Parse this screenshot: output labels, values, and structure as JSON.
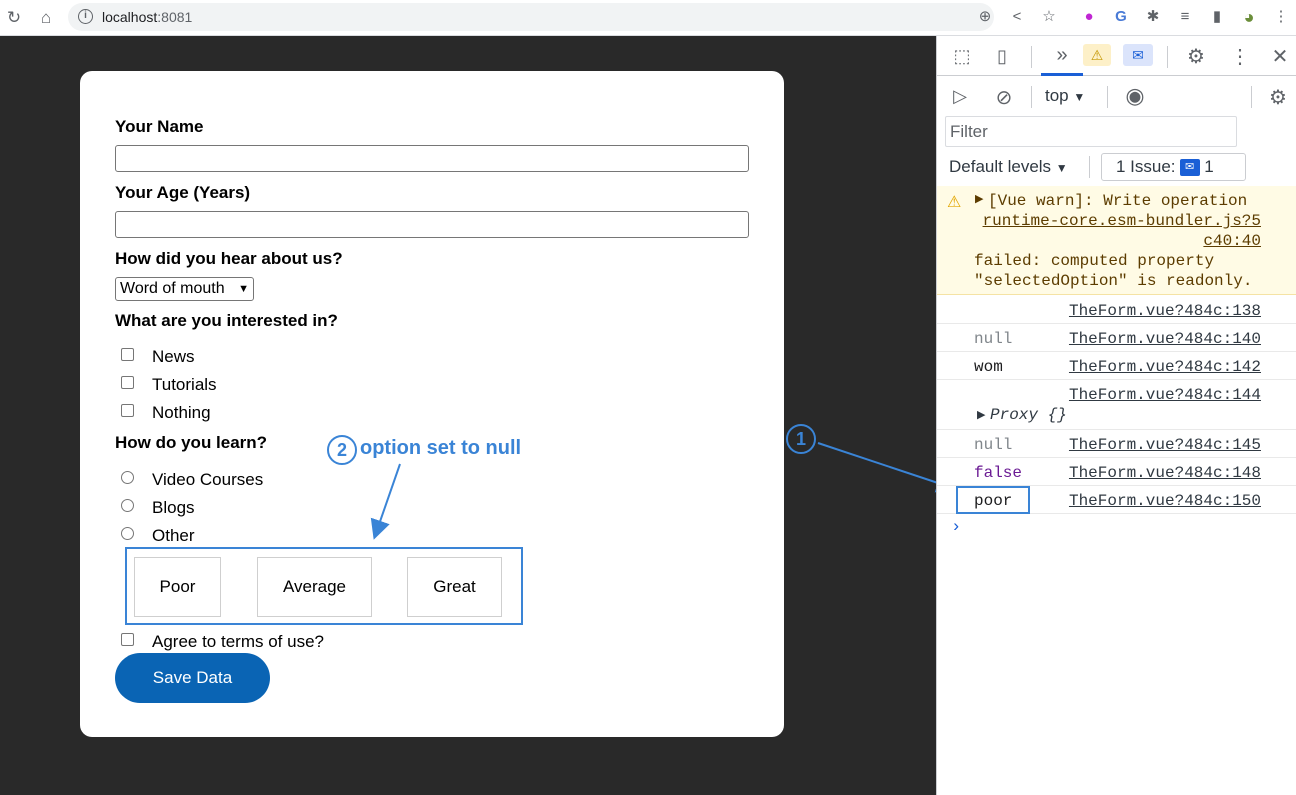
{
  "browser": {
    "url_host": "localhost",
    "url_port": ":8081",
    "back_glyph": "↻",
    "home_glyph": "⌂",
    "info_glyph": "i",
    "toolbar_icons": [
      {
        "name": "zoom-icon",
        "glyph": "⊕"
      },
      {
        "name": "share-icon",
        "glyph": "<"
      },
      {
        "name": "star-icon",
        "glyph": "☆"
      },
      {
        "name": "extension-a-icon",
        "glyph": "●"
      },
      {
        "name": "translate-icon",
        "glyph": "G"
      },
      {
        "name": "puzzle-icon",
        "glyph": "✱"
      },
      {
        "name": "playlist-icon",
        "glyph": "≡"
      },
      {
        "name": "sidepanel-icon",
        "glyph": "▮"
      },
      {
        "name": "profile-avatar",
        "glyph": "◕"
      },
      {
        "name": "kebab-menu-icon",
        "glyph": "⋮"
      }
    ]
  },
  "form": {
    "name_label": "Your Name",
    "age_label": "Your Age (Years)",
    "referrer_label": "How did you hear about us?",
    "referrer_value": "Word of mouth",
    "interests_label": "What are you interested in?",
    "interests": [
      "News",
      "Tutorials",
      "Nothing"
    ],
    "learn_label": "How do you learn?",
    "learn_options": [
      "Video Courses",
      "Blogs",
      "Other"
    ],
    "ratings": [
      "Poor",
      "Average",
      "Great"
    ],
    "terms_label": "Agree to terms of use?",
    "save_label": "Save Data"
  },
  "annotations": {
    "one": "1",
    "two": "2",
    "two_text": "option set to null"
  },
  "devtools": {
    "context": "top",
    "filter_placeholder": "Filter",
    "levels": "Default levels",
    "issues_label": "1 Issue:",
    "issues_count": "1",
    "warning": {
      "msg1": "[Vue warn]: Write operation",
      "src1": "runtime-core.esm-bundler.js?5",
      "src2": "c40:40",
      "msg2": "failed: computed property",
      "msg3": "\"selectedOption\" is readonly."
    },
    "logs": [
      {
        "value": "",
        "kind": "plain",
        "source": "TheForm.vue?484c:138"
      },
      {
        "value": "null",
        "kind": "null",
        "source": "TheForm.vue?484c:140"
      },
      {
        "value": "wom",
        "kind": "plain",
        "source": "TheForm.vue?484c:142"
      },
      {
        "value": "",
        "kind": "plain",
        "source": "TheForm.vue?484c:144"
      },
      {
        "value": "null",
        "kind": "null",
        "source": "TheForm.vue?484c:145"
      },
      {
        "value": "false",
        "kind": "bool",
        "source": "TheForm.vue?484c:148"
      },
      {
        "value": "poor",
        "kind": "plain",
        "source": "TheForm.vue?484c:150"
      }
    ],
    "proxy_label": "Proxy {}"
  },
  "colors": {
    "accent": "#3a84d6",
    "save_button": "#0a64b4",
    "page_bg": "#292929"
  }
}
